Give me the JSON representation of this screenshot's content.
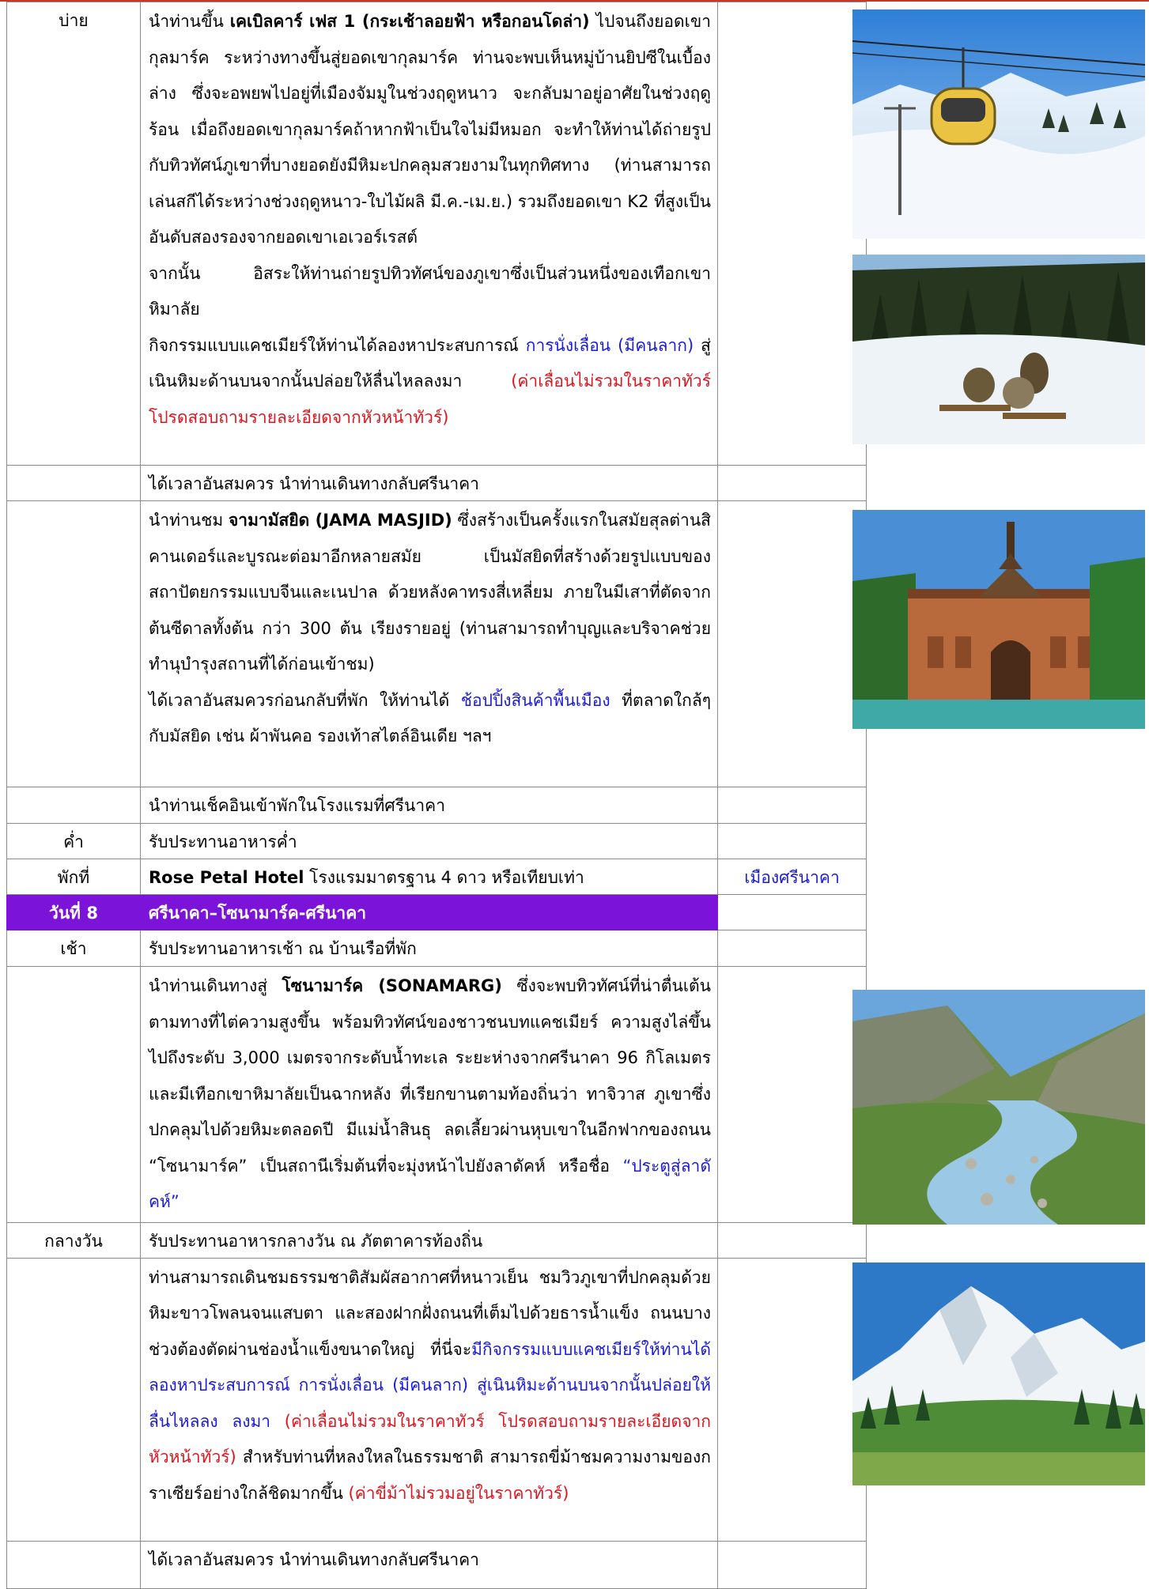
{
  "rows": [
    {
      "label": "บ่าย",
      "p1_pre": "นำท่านขึ้น ",
      "p1_bold": "เคเบิลคาร์ เฟส 1 (กระเช้าลอยฟ้า หรือกอนโดล่า)",
      "p1_post": " ไปจนถึงยอดเขากุลมาร์ค ระหว่างทางขึ้นสู่ยอดเขากุลมาร์ค ท่านจะพบเห็นหมู่บ้านยิปซีในเบื้องล่าง ซึ่งจะอพยพไปอยู่ที่เมืองจัมมูในช่วงฤดูหนาว จะกลับมาอยู่อาศัยในช่วงฤดูร้อน เมื่อถึงยอดเขากุลมาร์คถ้าหากฟ้าเป็นใจไม่มีหมอก จะทำให้ท่านได้ถ่ายรูปกับทิวทัศน์ภูเขาที่บางยอดยังมีหิมะปกคลุมสวยงามในทุกทิศทาง (ท่านสามารถเล่นสกีได้ระหว่างช่วงฤดูหนาว-ใบไม้ผลิ มี.ค.-เม.ย.) รวมถึงยอดเขา K2 ที่สูงเป็นอันดับสองรองจากยอดเขาเอเวอร์เรสต์",
      "p2": "จากนั้น อิสระให้ท่านถ่ายรูปทิวทัศน์ของภูเขาซึ่งเป็นส่วนหนึ่งของเทือกเขาหิมาลัย",
      "p3_pre": "กิจกรรมแบบแคชเมียร์ให้ท่านได้ลองหาประสบการณ์ ",
      "p3_blue": "การนั่งเลื่อน (มีคนลาก)",
      "p3_mid": " สู่เนินหิมะด้านบนจากนั้นปล่อยให้ลื่นไหลลงมา ",
      "p3_red": "(ค่าเลื่อนไม่รวมในราคาทัวร์ โปรดสอบถามรายละเอียดจากหัวหน้าทัวร์)"
    },
    {
      "label": "",
      "text": "ได้เวลาอันสมควร นำท่านเดินทางกลับศรีนาคา"
    },
    {
      "label": "",
      "p1_pre": "นำท่านชม ",
      "p1_bold": "จามามัสยิด (JAMA MASJID)",
      "p1_post": " ซึ่งสร้างเป็นครั้งแรกในสมัยสุลต่านสิคานเดอร์และบูรณะต่อมาอีกหลายสมัย เป็นมัสยิดที่สร้างด้วยรูปแบบของสถาปัตยกรรมแบบจีนและเนปาล ด้วยหลังคาทรงสี่เหลี่ยม ภายในมีเสาที่ตัดจากต้นซีดาลทั้งต้น กว่า 300 ต้น เรียงรายอยู่ (ท่านสามารถทำบุญและบริจาคช่วยทำนุบำรุงสถานที่ได้ก่อนเข้าชม)",
      "p2_pre": "ได้เวลาอันสมควรก่อนกลับที่พัก ให้ท่านได้ ",
      "p2_blue": "ช้อปปิ้งสินค้าพื้นเมือง",
      "p2_post": " ที่ตลาดใกล้ๆกับมัสยิด เช่น ผ้าพันคอ รองเท้าสไตล์อินเดีย ฯลฯ"
    },
    {
      "label": "",
      "text": "นำท่านเช็คอินเข้าพักในโรงแรมที่ศรีนาคา"
    },
    {
      "label": "ค่ำ",
      "text": "รับประทานอาหารค่ำ"
    },
    {
      "label": "พักที่",
      "hotel_bold": "Rose Petal Hotel",
      "hotel_rest": " โรงแรมมาตรฐาน 4 ดาว หรือเทียบเท่า",
      "city": "เมืองศรีนาคา"
    },
    {
      "label": "วันที่ 8",
      "text": "ศรีนาคา–โซนามาร์ค-ศรีนาคา"
    },
    {
      "label": "เช้า",
      "text": "รับประทานอาหารเช้า ณ บ้านเรือที่พัก"
    },
    {
      "label": "",
      "p1_pre": "นำท่านเดินทางสู่ ",
      "p1_bold": "โซนามาร์ค (SONAMARG)",
      "p1_post": " ซึ่งจะพบทิวทัศน์ที่น่าตื่นเต้นตามทางที่ไต่ความสูงขึ้น  พร้อมทิวทัศน์ของชาวชนบทแคชเมียร์  ความสูงไล่ขึ้นไปถึงระดับ 3,000 เมตรจากระดับน้ำทะเล ระยะห่างจากศรีนาคา 96 กิโลเมตร และมีเทือกเขาหิมาลัยเป็นฉากหลัง  ที่เรียกขานตามท้องถิ่นว่า  ทาจิวาส  ภูเขาซึ่งปกคลุมไปด้วยหิมะตลอดปี มีแม่น้ำสินธุ ลดเลี้ยวผ่านหุบเขาในอีกฟากของถนน “โซนามาร์ค” เป็นสถานีเริ่มต้นที่จะมุ่งหน้าไปยังลาดัคห์ หรือชื่อ ",
      "p1_blue": "“ประตูสู่ลาดัคห์”"
    },
    {
      "label": "กลางวัน",
      "text": "รับประทานอาหารกลางวัน ณ ภัตตาคารท้องถิ่น"
    },
    {
      "label": "",
      "p1_pre": "ท่านสามารถเดินชมธรรมชาติสัมผัสอากาศที่หนาวเย็น ชมวิวภูเขาที่ปกคลุมด้วยหิมะขาวโพลนจนแสบตา และสองฝากฝั่งถนนที่เต็มไปด้วยธารน้ำแข็ง ถนนบางช่วงต้องตัดผ่านช่องน้ำแข็งขนาดใหญ่ ที่นี่จะ",
      "p1_blue": "มีกิจกรรมแบบแคชเมียร์ให้ท่านได้ลองหาประสบการณ์ การนั่งเลื่อน (มีคนลาก) สู่เนินหิมะด้านบนจากนั้นปล่อยให้ลื่นไหลลง ลงมา",
      "p1_red": " (ค่าเลื่อนไม่รวมในราคาทัวร์ โปรดสอบถามรายละเอียดจากหัวหน้าทัวร์)",
      "p1_post": " สำหรับท่านที่หลงใหลในธรรมชาติ สามารถขี่ม้าชมความงามของกราเซียร์อย่างใกล้ชิดมากขึ้น ",
      "p1_red2": "(ค่าขี่ม้าไม่รวมอยู่ในราคาทัวร์)"
    },
    {
      "label": "",
      "text": "ได้เวลาอันสมควร นำท่านเดินทางกลับศรีนาคา"
    }
  ],
  "colors": {
    "day_header": "#7b14d8",
    "link_blue": "#1a1adb",
    "note_red": "#e0141e"
  },
  "images": [
    "gondola-photo",
    "sled-photo",
    "jama-masjid-photo",
    "sonamarg-river-photo",
    "himalaya-peak-photo"
  ]
}
